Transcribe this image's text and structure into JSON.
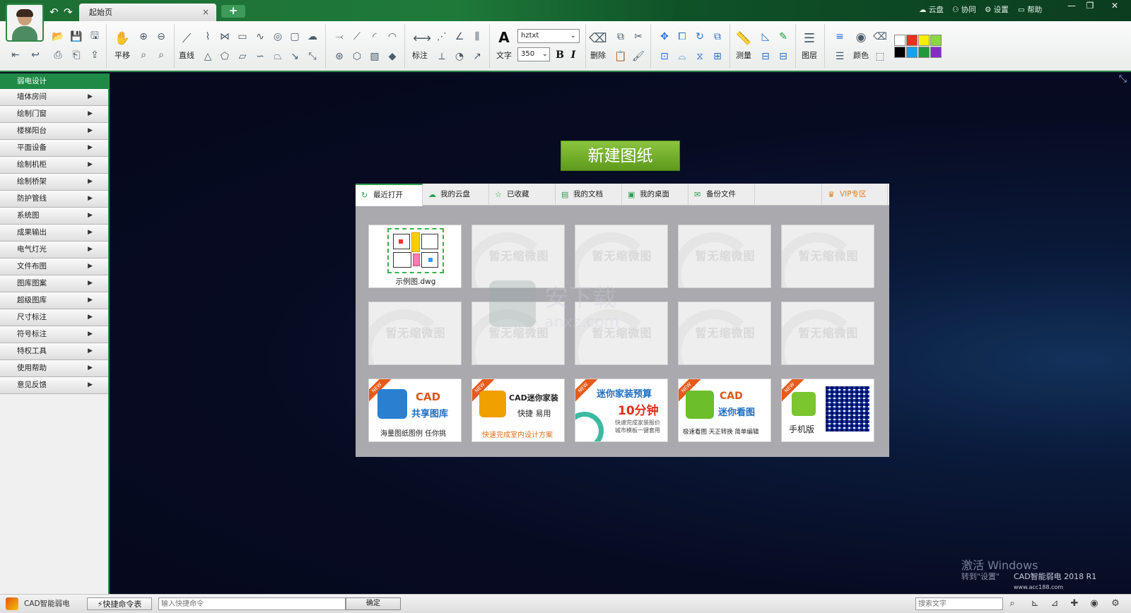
{
  "titlebar": {
    "tab_label": "起始页",
    "tab_close": "×",
    "tab_add": "+",
    "links": [
      "云盘",
      "协同",
      "设置",
      "帮助"
    ],
    "window_controls": [
      "—",
      "❐",
      "✕"
    ]
  },
  "ribbon": {
    "pan_label": "平移",
    "line_label": "直线",
    "dim_label": "标注",
    "text_label": "文字",
    "font_value": "hztxt",
    "size_value": "350",
    "bold": "B",
    "italic": "I",
    "delete_label": "删除",
    "measure_label": "测量",
    "layer_label": "图层",
    "color_label": "颜色",
    "swatches": [
      "#ffffff",
      "#e8301c",
      "#f7f000",
      "#8bd83a",
      "#000000",
      "#1aa0e8",
      "#1f9a3a",
      "#8a2ac8"
    ]
  },
  "sidebar": {
    "header": "弱电设计",
    "items": [
      "墙体房间",
      "绘制门窗",
      "楼梯阳台",
      "平面设备",
      "绘制机柜",
      "绘制桥架",
      "防护管线",
      "系统图",
      "成果输出",
      "电气灯光",
      "文件布图",
      "图库图案",
      "超级图库",
      "尺寸标注",
      "符号标注",
      "特权工具",
      "使用帮助",
      "意见反馈"
    ]
  },
  "main": {
    "new_drawing": "新建图纸",
    "tabs": [
      "最近打开",
      "我的云盘",
      "已收藏",
      "我的文档",
      "我的桌面",
      "备份文件"
    ],
    "vip": "VIP专区",
    "recent_file": "示例图.dwg",
    "no_thumb": "暂无缩微图",
    "ads": [
      {
        "title": "CAD",
        "sub": "共享图库",
        "foot": "海量图纸图例 任你挑"
      },
      {
        "title": "CAD迷你家装",
        "sub": "快捷 易用",
        "foot": "快速完成室内设计方案"
      },
      {
        "title": "迷你家装预算",
        "sub": "10分钟",
        "foot": "快速完成家装报价 城市模板一键套用"
      },
      {
        "title": "CAD",
        "sub": "迷你看图",
        "foot": "极速看图 天正转换 简单编辑"
      },
      {
        "title": "手机版",
        "sub": "",
        "foot": ""
      }
    ]
  },
  "status": {
    "app_name": "CAD智能弱电",
    "quick_cmd": "快捷命令表",
    "cmd_placeholder": "输入快捷命令",
    "confirm": "确定",
    "search_placeholder": "搜索文字"
  },
  "overlay": {
    "activate_line1": "激活 Windows",
    "activate_line2": "转到\"设置\"",
    "product": "CAD智能弱电 2018 R1",
    "site": "www.acc188.com"
  }
}
